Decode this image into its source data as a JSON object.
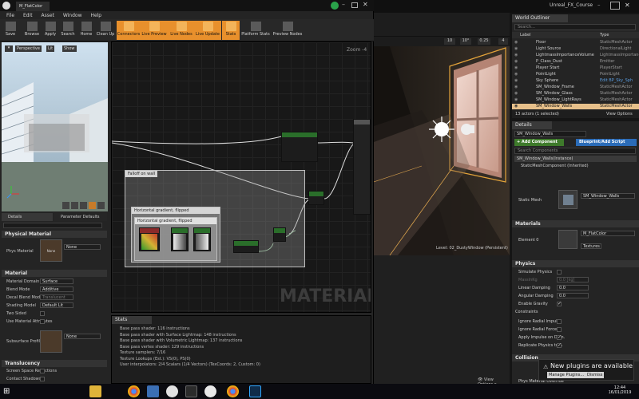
{
  "material_editor": {
    "title": "M_FlatColor",
    "menu": [
      "File",
      "Edit",
      "Asset",
      "Window",
      "Help"
    ],
    "toolbar": [
      {
        "label": "Save",
        "active": false
      },
      {
        "label": "Browse",
        "active": false
      },
      {
        "label": "Apply",
        "active": false
      },
      {
        "label": "Search",
        "active": false
      },
      {
        "label": "Home",
        "active": false
      },
      {
        "label": "Clean Up",
        "active": false
      },
      {
        "label": "Connectors",
        "active": true
      },
      {
        "label": "Live Preview",
        "active": true
      },
      {
        "label": "Live Nodes",
        "active": true
      },
      {
        "label": "Live Update",
        "active": true
      },
      {
        "label": "Stats",
        "active": true
      },
      {
        "label": "Platform Stats",
        "active": false
      },
      {
        "label": "Preview Nodes",
        "active": false
      }
    ],
    "viewport_buttons": {
      "perspective": "Perspective",
      "lit": "Lit",
      "show": "Show"
    },
    "details_tab": "Details",
    "param_tab": "Parameter Defaults",
    "phys_section": "Physical Material",
    "phys_label": "Phys Material",
    "phys_value": "None",
    "material_section": "Material",
    "props": [
      {
        "label": "Material Domain",
        "value": "Surface",
        "type": "dropdown"
      },
      {
        "label": "Blend Mode",
        "value": "Additive",
        "type": "dropdown"
      },
      {
        "label": "Decal Blend Mode",
        "value": "Translucent",
        "type": "dropdown"
      },
      {
        "label": "Shading Model",
        "value": "Default Lit",
        "type": "dropdown"
      },
      {
        "label": "Two Sided",
        "checked": false,
        "type": "checkbox"
      },
      {
        "label": "Use Material Attributes",
        "checked": false,
        "type": "checkbox"
      }
    ],
    "subsurface_label": "Subsurface Profile",
    "subsurface_value": "None",
    "translucency_section": "Translucency",
    "translucency_props": [
      {
        "label": "Screen Space Reflections",
        "checked": false
      },
      {
        "label": "Contact Shadows",
        "checked": false
      }
    ],
    "graph": {
      "zoom": "Zoom -4",
      "watermark": "MATERIAL",
      "comments": [
        "Falloff on wall",
        "Horizontal gradient, flipped",
        "Horizontal gradient, flipped"
      ]
    },
    "stats_tab": "Stats",
    "stats": [
      "Base pass shader: 116 instructions",
      "Base pass shader with Surface Lightmap: 148 instructions",
      "Base pass shader with Volumetric Lightmap: 137 instructions",
      "Base pass vertex shader: 129 instructions",
      "Texture samplers: 7/16",
      "Texture Lookups (Est.): VS(0), PS(0)",
      "User interpolators: 2/4 Scalars (1/4 Vectors) (TexCoords: 2, Custom: 0)"
    ]
  },
  "main_editor": {
    "project": "Unreal_FX_Course",
    "snap_values": [
      "10",
      "10°",
      "0.25",
      "4"
    ],
    "viewport_label": "Level:  02_DustyWindow (Persistent)"
  },
  "world_outliner": {
    "title": "World Outliner",
    "search_placeholder": "Search...",
    "col_label": "Label",
    "col_type": "Type",
    "rows": [
      {
        "label": "Floor",
        "type": "StaticMeshActor"
      },
      {
        "label": "Light Source",
        "type": "DirectionalLight"
      },
      {
        "label": "LightmassImportanceVolume",
        "type": "LightmassImportanceV"
      },
      {
        "label": "P_Class_Dust",
        "type": "Emitter"
      },
      {
        "label": "Player Start",
        "type": "PlayerStart"
      },
      {
        "label": "PointLight",
        "type": "PointLight"
      },
      {
        "label": "Sky Sphere",
        "type": "Edit BP_Sky_Sph"
      },
      {
        "label": "SM_Window_Frame",
        "type": "StaticMeshActor"
      },
      {
        "label": "SM_Window_Glass",
        "type": "StaticMeshActor"
      },
      {
        "label": "SM_Window_LightRays",
        "type": "StaticMeshActor"
      },
      {
        "label": "SM_Window_Walls",
        "type": "StaticMeshActor",
        "selected": true
      }
    ],
    "footer": "13 actors (1 selected)",
    "view_options": "View Options"
  },
  "details": {
    "title": "Details",
    "actor_name": "SM_Window_Walls",
    "add_component": "+ Add Component",
    "blueprint_script": "Blueprint/Add Script",
    "search_placeholder": "Search Components",
    "components": [
      "SM_Window_Walls(Instance)",
      "StaticMeshComponent (Inherited)"
    ],
    "static_mesh_label": "Static Mesh",
    "static_mesh_value": "SM_Window_Walls",
    "materials_section": "Materials",
    "element_label": "Element 0",
    "element_value": "M_FlatColor",
    "element_sub": "Textures",
    "physics_section": "Physics",
    "physics_props": [
      {
        "label": "Simulate Physics",
        "kind": "check",
        "checked": false
      },
      {
        "label": "MassInKg",
        "kind": "text",
        "value": "0.0 [kg]",
        "disabled": true
      },
      {
        "label": "Linear Damping",
        "kind": "text",
        "value": "0.0"
      },
      {
        "label": "Angular Damping",
        "kind": "text",
        "value": "0.0"
      },
      {
        "label": "Enable Gravity",
        "kind": "check",
        "checked": true
      }
    ],
    "constraints_label": "Constraints",
    "constraint_props": [
      {
        "label": "Ignore Radial Impulse",
        "checked": false
      },
      {
        "label": "Ignore Radial Force",
        "checked": false
      },
      {
        "label": "Apply Impulse on Dam.",
        "checked": true
      },
      {
        "label": "Replicate Physics to A",
        "checked": true
      }
    ],
    "collision_section": "Collision",
    "phys_material_override": "Phys Material Override"
  },
  "notification": {
    "title": "New plugins are available",
    "manage": "Manage Plugins...",
    "dismiss": "Dismiss"
  },
  "taskbar": {
    "time": "12:44",
    "date": "16/01/2019"
  }
}
